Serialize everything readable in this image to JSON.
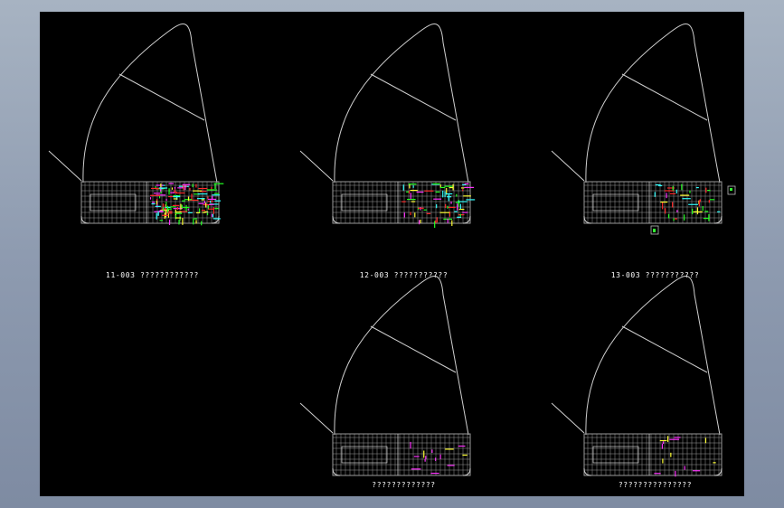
{
  "colors": {
    "background": "#8e9bb0",
    "model_space": "#000000",
    "outline": "#cfcfcf",
    "floor_grid": "#9a9a9a",
    "detail_green": "#22ff22",
    "detail_red": "#ff2a2a",
    "detail_magenta": "#ff33ff",
    "detail_yellow": "#ffff33",
    "detail_cyan": "#33ffff",
    "text": "#ffffff"
  },
  "sheets": [
    {
      "id": "s1",
      "caption": "11-003 ????????????",
      "detail_density": "high"
    },
    {
      "id": "s2",
      "caption": "12-003 ???????????",
      "detail_density": "medium"
    },
    {
      "id": "s3",
      "caption": "13-003 ???????????",
      "detail_density": "low"
    },
    {
      "id": "s4",
      "caption": "?????????????",
      "detail_density": "sparse"
    },
    {
      "id": "s5",
      "caption": "???????????????",
      "detail_density": "sparse"
    }
  ]
}
